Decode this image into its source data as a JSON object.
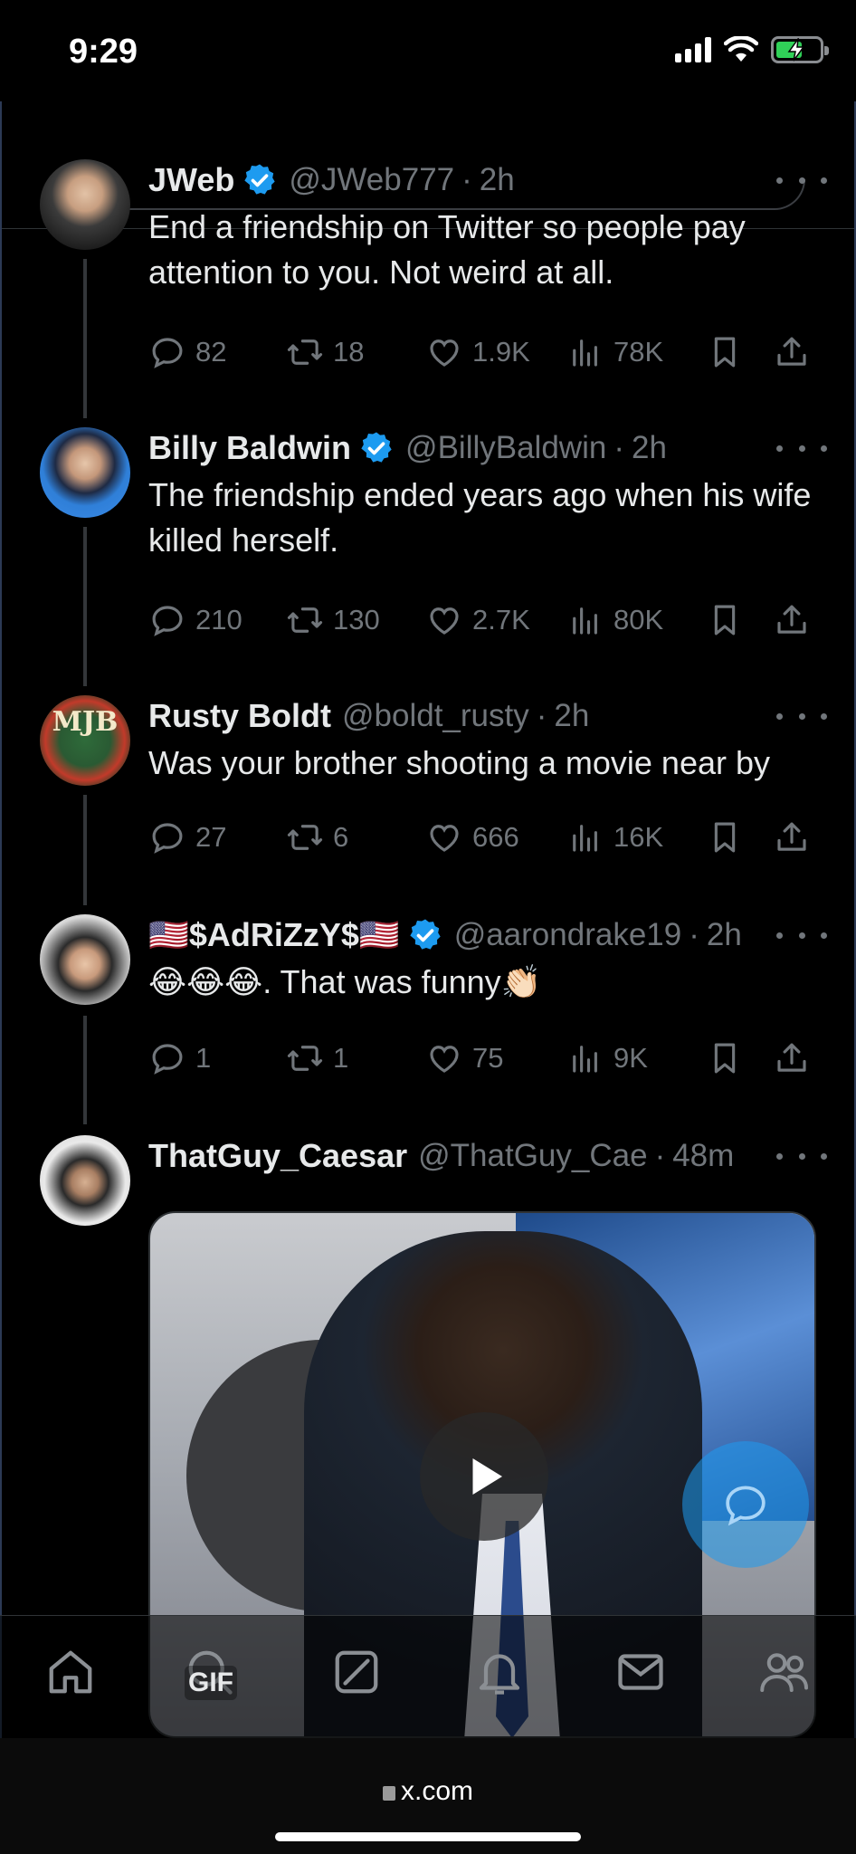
{
  "status_bar": {
    "time": "9:29"
  },
  "colors": {
    "accent": "#1d9bf0",
    "verified": "#1d9bf0",
    "muted": "#71767b",
    "battery": "#30d158"
  },
  "tweets": [
    {
      "name": "JWeb",
      "verified": true,
      "handle": "@JWeb777",
      "time": "2h",
      "text": "End a friendship on Twitter so people pay attention to you. Not weird at all.",
      "replies": "82",
      "reposts": "18",
      "likes": "1.9K",
      "views": "78K"
    },
    {
      "name": "Billy Baldwin",
      "verified": true,
      "handle": "@BillyBaldwin",
      "time": "2h",
      "text": "The friendship ended years ago when his wife killed herself.",
      "replies": "210",
      "reposts": "130",
      "likes": "2.7K",
      "views": "80K"
    },
    {
      "name": "Rusty Boldt",
      "verified": false,
      "handle": "@boldt_rusty",
      "time": "2h",
      "text": "Was your brother shooting a movie near by",
      "replies": "27",
      "reposts": "6",
      "likes": "666",
      "views": "16K",
      "avatar_text": "MJB"
    },
    {
      "name": "🇺🇸$AdRiZzY$🇺🇸",
      "verified": true,
      "handle": "@aarondrake19",
      "time": "2h",
      "text": "😂😂😂. That was funny👏🏻",
      "replies": "1",
      "reposts": "1",
      "likes": "75",
      "views": "9K"
    },
    {
      "name": "ThatGuy_Caesar",
      "verified": false,
      "handle": "@ThatGuy_Cae",
      "time": "48m",
      "media_label": "GIF"
    }
  ],
  "bottom_nav": [
    "home-icon",
    "search-icon",
    "grok-icon",
    "notifications-icon",
    "messages-icon",
    "communities-icon"
  ],
  "browser": {
    "url": "x.com"
  }
}
